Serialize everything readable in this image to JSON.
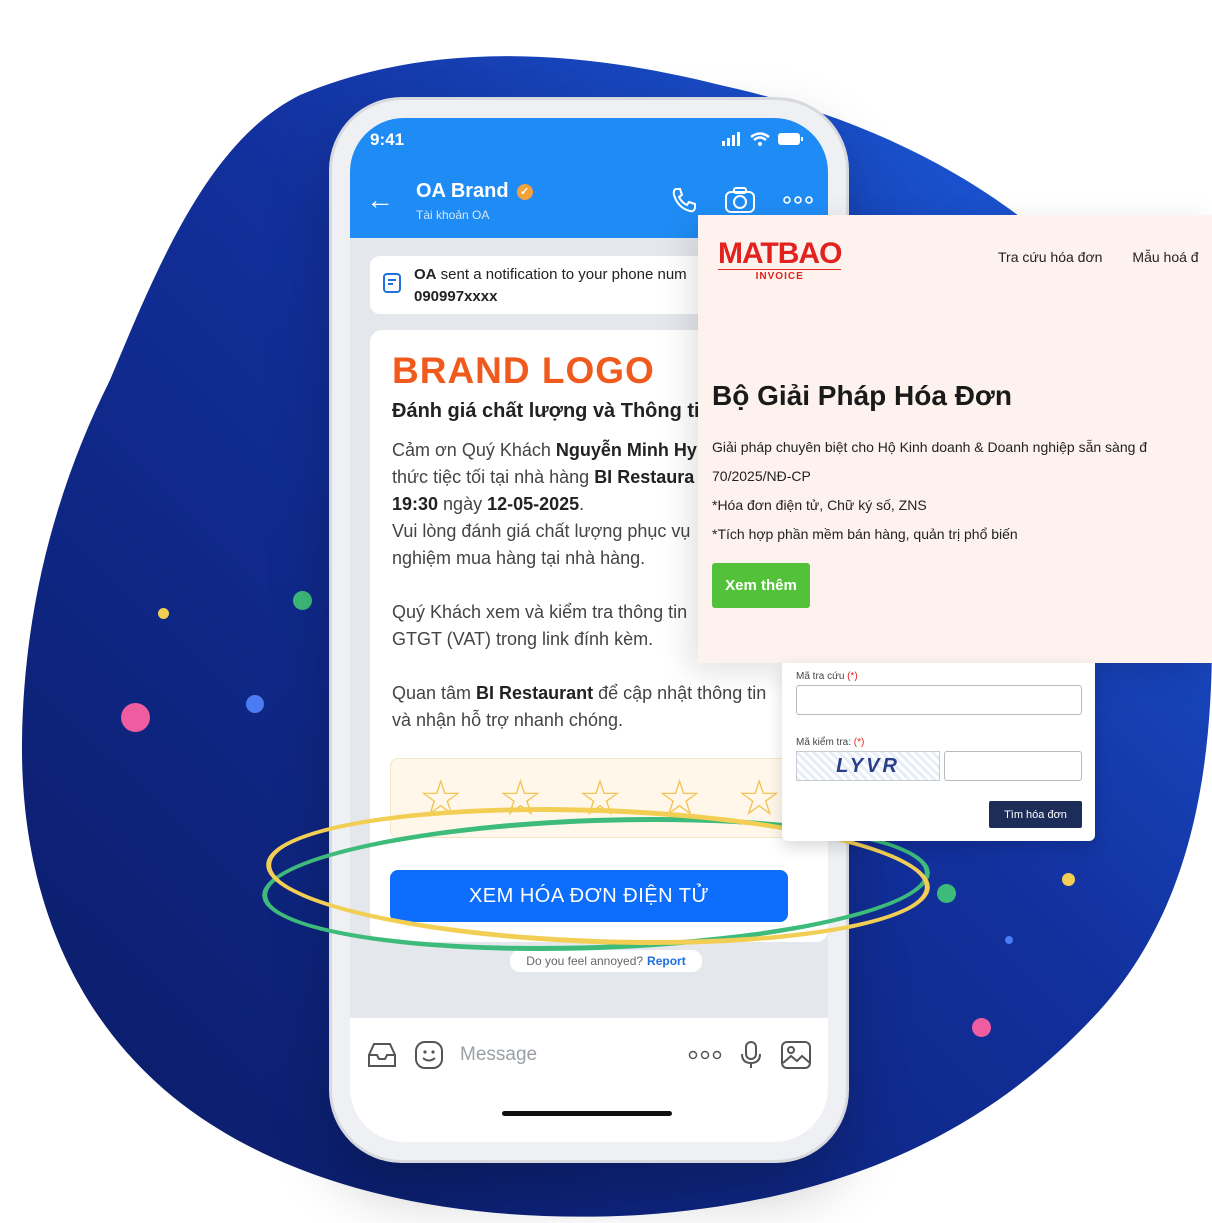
{
  "colors": {
    "phone_blue": "#1f8cf5",
    "button_blue": "#0d6efd",
    "brand_orange": "#f05a1d",
    "matbao_red": "#e2221e",
    "green_button": "#53c13a",
    "blob_dark": "#0c1f7a",
    "ring_green": "#3dbb7a",
    "ring_yellow": "#f2cf54"
  },
  "phone": {
    "status_time": "9:41",
    "oa_name": "OA Brand",
    "oa_subtitle": "Tài khoản OA",
    "notification_text": "sent a notification to your phone num",
    "notification_sender": "OA",
    "notification_phone": "090997xxxx",
    "brand_logo": "BRAND LOGO",
    "card_title": "Đánh giá chất lượng và Thông tin",
    "p1_line1_a": "Cảm ơn Quý Khách ",
    "p1_line1_b": "Nguyễn Minh Hy",
    "p1_line2_a": "thức tiệc tối tại nhà hàng ",
    "p1_line2_b": "BI Restaura",
    "p1_line3_a": "19:30",
    "p1_line3_b": " ngày ",
    "p1_line3_c": "12-05-2025",
    "p1_line3_d": ".",
    "p1_line4": "Vui lòng đánh giá chất lượng phục vụ",
    "p1_line5": "nghiệm mua hàng tại nhà hàng.",
    "p2_line1": "Quý Khách xem và kiểm tra thông tin",
    "p2_line2": "GTGT (VAT) trong link đính kèm.",
    "p3_line1_a": "Quan tâm ",
    "p3_line1_b": "BI Restaurant",
    "p3_line1_c": " để cập nhật thông tin",
    "p3_line2": "và nhận hỗ trợ nhanh chóng.",
    "rating_value": 0,
    "rating_max": 5,
    "cta_label": "XEM HÓA ĐƠN ĐIỆN TỬ",
    "report_prompt": "Do you feel annoyed?",
    "report_link": "Report",
    "message_placeholder": "Message",
    "more_label": "ooo"
  },
  "website": {
    "logo_word": "MATBAO",
    "logo_sub": "INVOICE",
    "nav": [
      "Tra cứu hóa đơn",
      "Mẫu hoá đ"
    ],
    "title": "Bộ Giải Pháp Hóa Đơn",
    "desc_line1": "Giải pháp chuyên biệt cho Hộ Kinh doanh & Doanh nghiệp sẵn sàng đ",
    "desc_line2": "70/2025/NĐ-CP",
    "desc_line3": "*Hóa đơn điện tử, Chữ ký số, ZNS",
    "desc_line4": "*Tích hợp phần mềm bán hàng, quản trị phổ biến",
    "button_label": "Xem thêm"
  },
  "lookup_form": {
    "code_label": "Mã tra cứu",
    "captcha_label": "Mã kiểm tra:",
    "required_mark": "(*)",
    "captcha_text": "LYVR",
    "code_value": "",
    "captcha_value": "",
    "submit_label": "Tìm hóa đơn"
  }
}
